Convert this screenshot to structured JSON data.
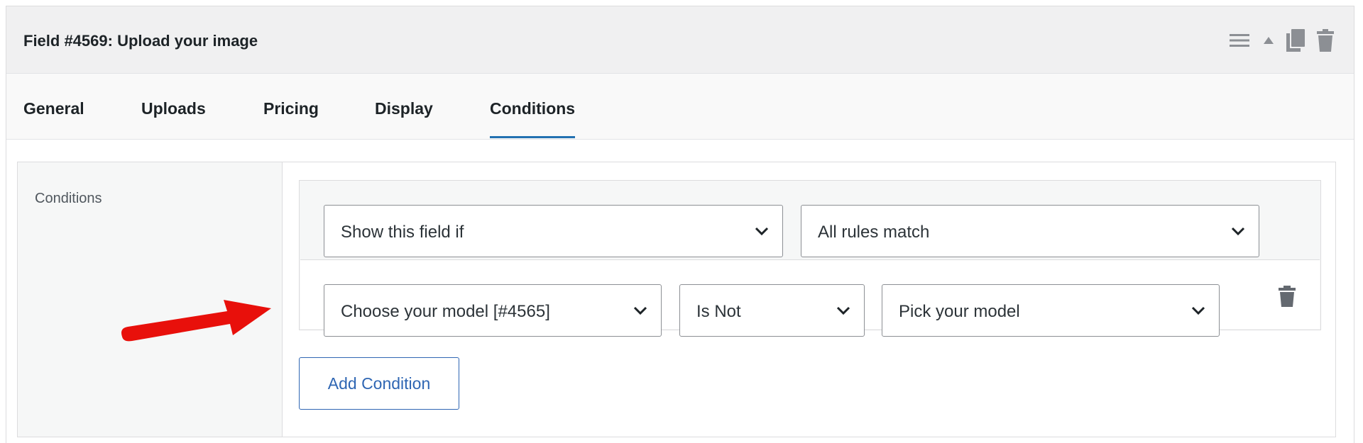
{
  "panel": {
    "title": "Field #4569: Upload your image",
    "header_icons": [
      "menu-icon",
      "collapse-up-icon",
      "duplicate-icon",
      "trash-icon"
    ]
  },
  "tabs": [
    {
      "label": "General",
      "active": false
    },
    {
      "label": "Uploads",
      "active": false
    },
    {
      "label": "Pricing",
      "active": false
    },
    {
      "label": "Display",
      "active": false
    },
    {
      "label": "Conditions",
      "active": true
    }
  ],
  "conditions": {
    "section_label": "Conditions",
    "visibility_select": {
      "value": "Show this field if"
    },
    "match_select": {
      "value": "All rules match"
    },
    "rules": [
      {
        "field": "Choose your model [#4565]",
        "operator": "Is Not",
        "value": "Pick your model"
      }
    ],
    "add_button_label": "Add Condition"
  },
  "colors": {
    "accent": "#2271b1",
    "button_text": "#2f66b3",
    "annotation_arrow": "#e8100b",
    "header_bg": "#f0f0f1"
  }
}
